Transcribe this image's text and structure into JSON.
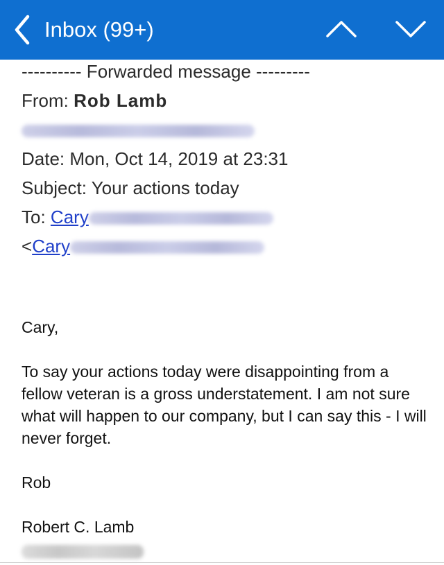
{
  "header": {
    "back_icon": "chevron-left-icon",
    "inbox_label": "Inbox (99+)",
    "prev_icon": "chevron-up-icon",
    "next_icon": "chevron-down-icon",
    "bar_color": "#0f6fd0"
  },
  "forward": {
    "divider_text": "---------- Forwarded message ---------",
    "from_label": "From:",
    "from_name": "Rob Lamb",
    "date_line": "Date: Mon, Oct 14, 2019 at 23:31",
    "subject_line": "Subject: Your actions today",
    "to_label": "To:",
    "to_name": "Cary",
    "to_bracket": "<",
    "to_name_2": "Cary"
  },
  "message": {
    "greeting": "Cary,",
    "paragraph": "To say your actions today were disappointing from a fellow veteran is a gross understatement.  I am not sure what will happen to our company, but I can say this - I will never forget.",
    "signoff": "Rob",
    "signature_name": "Robert C. Lamb"
  }
}
